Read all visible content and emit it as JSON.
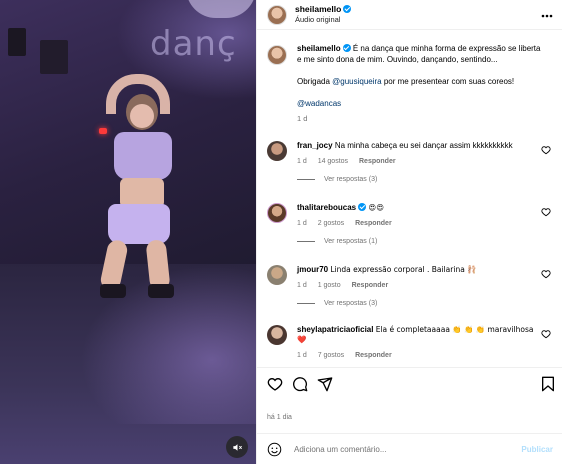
{
  "video": {
    "wall_text": "danç",
    "mute_icon": "speaker-muted-icon"
  },
  "header": {
    "username": "sheilamello",
    "audio": "Áudio original",
    "more_icon": "more-horizontal-icon"
  },
  "caption": {
    "username": "sheilamello",
    "text": "É na dança que minha forma de expressão se liberta e me sinto dona de mim. Ouvindo, dançando, sentindo...",
    "thanks_prefix": "Obrigada ",
    "thanks_mention": "@guusiqueira",
    "thanks_suffix": " por me presentear com suas coreos!",
    "mention2": "@wadancas",
    "age": "1 d"
  },
  "comments": [
    {
      "username": "fran_jocy",
      "text": "Na minha cabeça eu sei dançar assim kkkkkkkkkk",
      "age": "1 d",
      "likes": "14 gostos",
      "reply": "Responder",
      "view_replies": "Ver respostas (3)",
      "avatar_color": "#6b5a50"
    },
    {
      "username": "thalitareboucas",
      "text": "😍😍",
      "age": "1 d",
      "likes": "2 gostos",
      "reply": "Responder",
      "view_replies": "Ver respostas (1)",
      "avatar_color": "#7a5a40"
    },
    {
      "username": "jmour70",
      "text": "Linda expressão corporal . Bailarina 🩰",
      "age": "1 d",
      "likes": "1 gosto",
      "reply": "Responder",
      "view_replies": "Ver respostas (3)",
      "avatar_color": "#8a7a60"
    },
    {
      "username": "sheylapatriciaoficial",
      "text": "Ela é completaaaaa 👏 👏 👏 maravilhosa ❤️",
      "age": "1 d",
      "likes": "7 gostos",
      "reply": "Responder",
      "avatar_color": "#6a5a58"
    }
  ],
  "actions": {
    "like_icon": "heart-outline-icon",
    "comment_icon": "comment-icon",
    "share_icon": "send-icon",
    "save_icon": "bookmark-icon"
  },
  "timestamp": "há 1 dia",
  "add_comment": {
    "placeholder": "Adiciona um comentário...",
    "publish": "Publicar",
    "emoji_icon": "smiley-icon"
  },
  "colors": {
    "verified": "#0095f6",
    "link": "#00376b",
    "muted": "#737373",
    "publish_disabled": "#b2dffc"
  }
}
